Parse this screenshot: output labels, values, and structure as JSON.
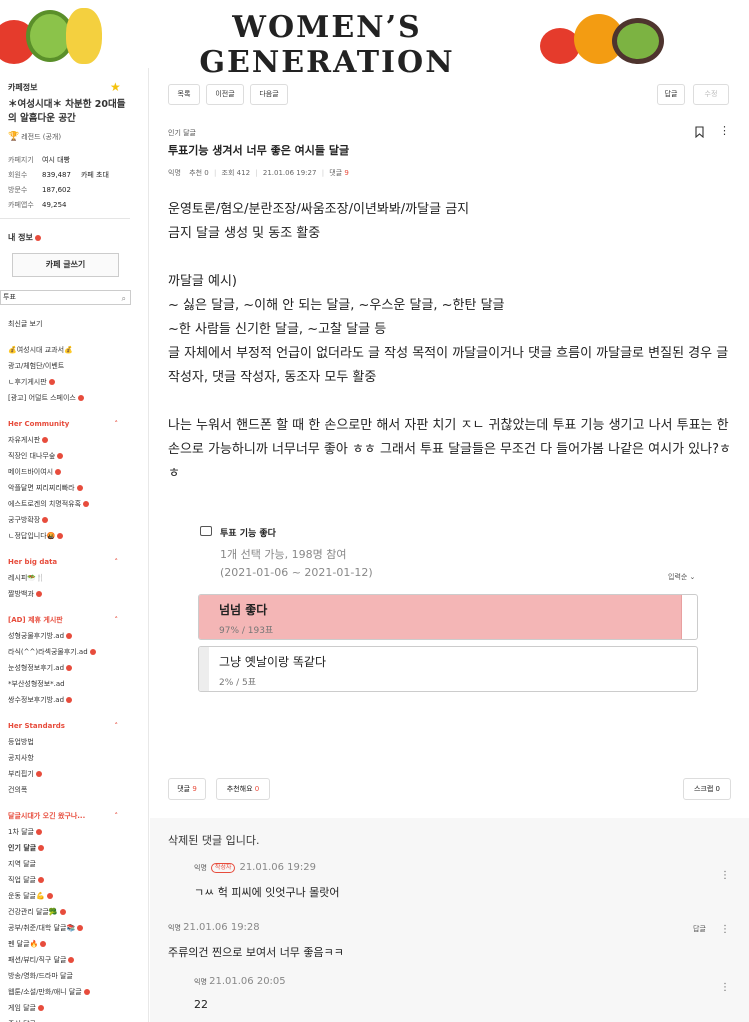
{
  "banner": {
    "title": "WOMEN’S GENERATION"
  },
  "sidebar": {
    "cafe_info_label": "카페정보",
    "cafe_name": "＊여성시대＊ 차분한 20대들의 알흠다운 공간",
    "level": "레전드 (공개)",
    "stats": [
      {
        "key": "카페지기",
        "value": "여시 대빵",
        "extra": ""
      },
      {
        "key": "회원수",
        "value": "839,487",
        "extra": "카페 초대"
      },
      {
        "key": "방문수",
        "value": "187,602",
        "extra": ""
      },
      {
        "key": "카페앱수",
        "value": "49,254",
        "extra": ""
      }
    ],
    "my_info": "내 정보",
    "write_button": "카페 글쓰기",
    "search_value": "투표",
    "menu": [
      {
        "t": "item",
        "label": "최신글 보기"
      },
      {
        "t": "gap"
      },
      {
        "t": "item",
        "label": "💰여성시대 교과서💰"
      },
      {
        "t": "item",
        "label": "광고/체험단/이벤트"
      },
      {
        "t": "item",
        "label": "ㄴ후기게시판",
        "badge": true
      },
      {
        "t": "item",
        "label": "[광고] 어덜트 스페이스",
        "badge": true
      },
      {
        "t": "gap"
      },
      {
        "t": "head",
        "label": "Her Community"
      },
      {
        "t": "item",
        "label": "자유게시판",
        "badge": true
      },
      {
        "t": "item",
        "label": "직장인 대나무숲",
        "badge": true
      },
      {
        "t": "item",
        "label": "메이드바이여시",
        "badge": true
      },
      {
        "t": "item",
        "label": "악플달면 찌리찌리빠라",
        "badge": true
      },
      {
        "t": "item",
        "label": "에스트로겐의 치명적유혹",
        "badge": true
      },
      {
        "t": "item",
        "label": "궁구방확장",
        "badge": true
      },
      {
        "t": "item",
        "label": "ㄴ정답입니다🤬",
        "badge": true
      },
      {
        "t": "gap"
      },
      {
        "t": "head",
        "label": "Her big data"
      },
      {
        "t": "item",
        "label": "레시피🥗🍴"
      },
      {
        "t": "item",
        "label": "짤방백과",
        "badge": true
      },
      {
        "t": "gap"
      },
      {
        "t": "head",
        "label": "[AD] 제휴 게시판"
      },
      {
        "t": "item",
        "label": "성형궁물후기방.ad",
        "badge": true
      },
      {
        "t": "item",
        "label": "라식(^^)라섹궁물후기.ad",
        "badge": true
      },
      {
        "t": "item",
        "label": "눈성형정보후기.ad",
        "badge": true
      },
      {
        "t": "item",
        "label": "*부산성형정보*.ad"
      },
      {
        "t": "item",
        "label": "쌍수정보후기방.ad",
        "badge": true
      },
      {
        "t": "gap"
      },
      {
        "t": "head",
        "label": "Her Standards"
      },
      {
        "t": "item",
        "label": "등업방법"
      },
      {
        "t": "item",
        "label": "공지사항"
      },
      {
        "t": "item",
        "label": "부리핍기",
        "badge": true
      },
      {
        "t": "item",
        "label": "건의폭"
      },
      {
        "t": "gap"
      },
      {
        "t": "head",
        "label": "달글시대가 오긴 왔구나..."
      },
      {
        "t": "item",
        "label": "1차 달글",
        "badge": true
      },
      {
        "t": "item",
        "label": "인기 달글",
        "badge": true,
        "bold": true
      },
      {
        "t": "item",
        "label": "지역 달글"
      },
      {
        "t": "item",
        "label": "직업 달글",
        "badge": true
      },
      {
        "t": "item",
        "label": "운동 달글💪",
        "badge": true
      },
      {
        "t": "item",
        "label": "건강관리 달글🥦",
        "badge": true
      },
      {
        "t": "item",
        "label": "공부/취준/대학 달글📚",
        "badge": true
      },
      {
        "t": "item",
        "label": "펜 달글🔥",
        "badge": true
      },
      {
        "t": "item",
        "label": "패션/뷰티/직구 달글",
        "badge": true
      },
      {
        "t": "item",
        "label": "방송/영화/드라마 달글"
      },
      {
        "t": "item",
        "label": "웹툰/소설/만화/애니 달글",
        "badge": true
      },
      {
        "t": "item",
        "label": "게임 달글",
        "badge": true
      },
      {
        "t": "item",
        "label": "주식 달글"
      }
    ]
  },
  "toolbar": {
    "list": "목록",
    "prev": "이전글",
    "next": "다음글",
    "reply": "답글",
    "edit": "수정"
  },
  "post": {
    "category": "인기 달글",
    "title": "투표기능 생겨서 너무 좋은 여시들 달글",
    "author": "익명",
    "recommend_label": "추천",
    "recommend_count": "0",
    "views_label": "조회",
    "views_count": "412",
    "date": "21.01.06 19:27",
    "comment_label": "댓글",
    "comment_count": "9",
    "body": "운영토론/혐오/분란조장/싸움조장/이년봐봐/까달글 금지\n금지 달글 생성 및 동조 활중\n\n까달글 예시)\n~ 싫은 달글, ~이해 안 되는 달글, ~우스운 달글, ~한탄 달글\n~한 사람들 신기한 달글, ~고찰 달글 등\n글 자체에서 부정적 언급이 없더라도 글 작성 목적이 까달글이거나 댓글 흐름이 까달글로 변질된 경우 글 작성자, 댓글 작성자, 동조자 모두 활중\n\n나는 누워서 핸드폰 할 때 한 손으로만 해서 자판 치기 ㅈㄴ 귀찮았는데 투표 기능 생기고 나서 투표는 한 손으로 가능하니까 너무너무 좋아 ㅎㅎ 그래서 투표 달글들은 무조건 다 들어가봄 나같은 여시가 있나?ㅎㅎ"
  },
  "poll": {
    "title": "투표 기능 좋다",
    "subtitle": "1개 선택 가능, 198명 참여",
    "period": "(2021-01-06 ~ 2021-01-12)",
    "sort": "입력순",
    "options": [
      {
        "label": "넘넘 좋다",
        "stat": "97% / 193표",
        "percent": 97
      },
      {
        "label": "그냥 옛날이랑 똑같다",
        "stat": "2% / 5표",
        "percent": 2
      }
    ]
  },
  "actions": {
    "comment_label": "댓글",
    "comment_count": "9",
    "recommend_label": "추천해요",
    "recommend_count": "0",
    "scrap_label": "스크랩",
    "scrap_count": "0"
  },
  "comments": {
    "deleted": "삭제된 댓글 입니다.",
    "list": [
      {
        "author": "익명",
        "writer_tag": "작성자",
        "time": "21.01.06 19:29",
        "text": "ㄱㅆ 헉 피씨에 잇엇구나 몰랏어"
      },
      {
        "author": "익명",
        "time": "21.01.06 19:28",
        "text": "주류의건 찐으로 보여서 너무 좋음ㅋㅋ",
        "reply": "답글"
      },
      {
        "author": "익명",
        "time": "21.01.06 20:05",
        "text": "22"
      }
    ]
  }
}
